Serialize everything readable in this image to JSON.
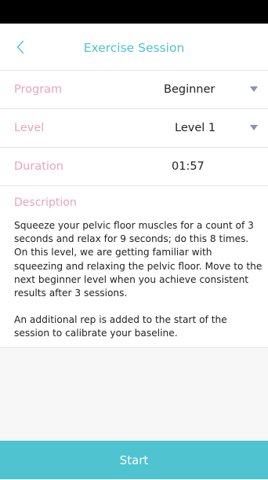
{
  "header": {
    "title": "Exercise Session",
    "back_icon": "chevron-left-icon"
  },
  "program": {
    "label": "Program",
    "value": "Beginner",
    "dropdown_icon": "triangle-down-icon"
  },
  "level": {
    "label": "Level",
    "value": "Level 1",
    "dropdown_icon": "triangle-down-icon"
  },
  "duration": {
    "label": "Duration",
    "value": "01:57"
  },
  "description": {
    "label": "Description",
    "paragraph_1": "Squeeze your pelvic floor muscles for a count of 3 seconds and relax for 9 seconds; do this 8 times. On this level, we are getting familiar with squeezing and relaxing the pelvic floor. Move to the next beginner level when you achieve consistent results after 3 sessions.",
    "paragraph_2": "An additional rep is added to the start of the session to calibrate your baseline."
  },
  "start_button": {
    "label": "Start"
  },
  "colors": {
    "accent": "#4fc3cf",
    "label_pink": "#e8a3c0",
    "dropdown_arrow": "#8a93b0",
    "divider": "#e6e6e6",
    "status_bar": "#000000"
  }
}
